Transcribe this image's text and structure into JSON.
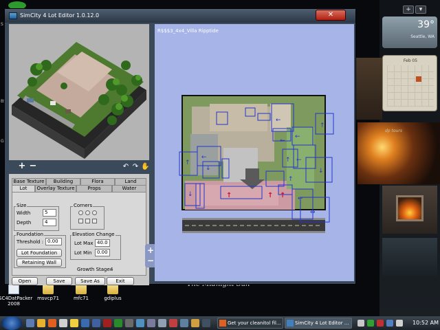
{
  "app": {
    "window_title": "SimCity 4 Lot Editor 1.0.12.0",
    "lot_name": "R$$$3_4x4_Villa Ripptide"
  },
  "toolbar": {
    "add_label": "+",
    "remove_label": "−",
    "rotate_left_icon": "rotate-left-icon",
    "rotate_right_icon": "rotate-right-icon",
    "hand_icon": "hand-pan-icon"
  },
  "tabs": {
    "row1": [
      "Base Texture",
      "Building",
      "Flora",
      "Land"
    ],
    "row2": [
      "Lot",
      "Overlay Texture",
      "Props",
      "Water"
    ],
    "active": "Lot"
  },
  "size": {
    "group_label": "Size",
    "width_label": "Width",
    "width_value": "5",
    "depth_label": "Depth",
    "depth_value": "4"
  },
  "corners": {
    "group_label": "Corners"
  },
  "foundation": {
    "group_label": "Foundation",
    "threshold_label": "Threshold :",
    "threshold_value": "0.00",
    "lot_foundation_button": "Lot Foundation",
    "retaining_wall_button": "Retaining Wall"
  },
  "elevation": {
    "group_label": "Elevation Change",
    "lot_max_label": "Lot Max",
    "lot_max_value": "40.0",
    "lot_min_label": "Lot Min",
    "lot_min_value": "0.00"
  },
  "growth_stage": {
    "label": "Growth Stage:",
    "value": "4"
  },
  "buttons": {
    "open": "Open",
    "save": "Save",
    "save_as": "Save As",
    "exit": "Exit"
  },
  "zoom": {
    "in": "+",
    "out": "−"
  },
  "desktop": {
    "icons": [
      {
        "label": "SC4DatPacker 2008"
      },
      {
        "label": "msvcp71"
      },
      {
        "label": "mfc71"
      },
      {
        "label": "gdiplus"
      }
    ],
    "weather_temp": "39°",
    "calendar_month": "Feb 05",
    "wallpaper_caption": "The Midnight Sun",
    "photo_caption": "dp tours"
  },
  "taskbar": {
    "tasks": [
      {
        "label": "Get your cleanitol fil..."
      },
      {
        "label": "SimCity 4 Lot Editor ..."
      }
    ],
    "time": "10:52 AM"
  },
  "colors": {
    "map_background": "#a6b4e8",
    "lot_outline": "#1a1a1a",
    "prop_box": "#2436c8",
    "arrow_red": "#c8102c"
  }
}
